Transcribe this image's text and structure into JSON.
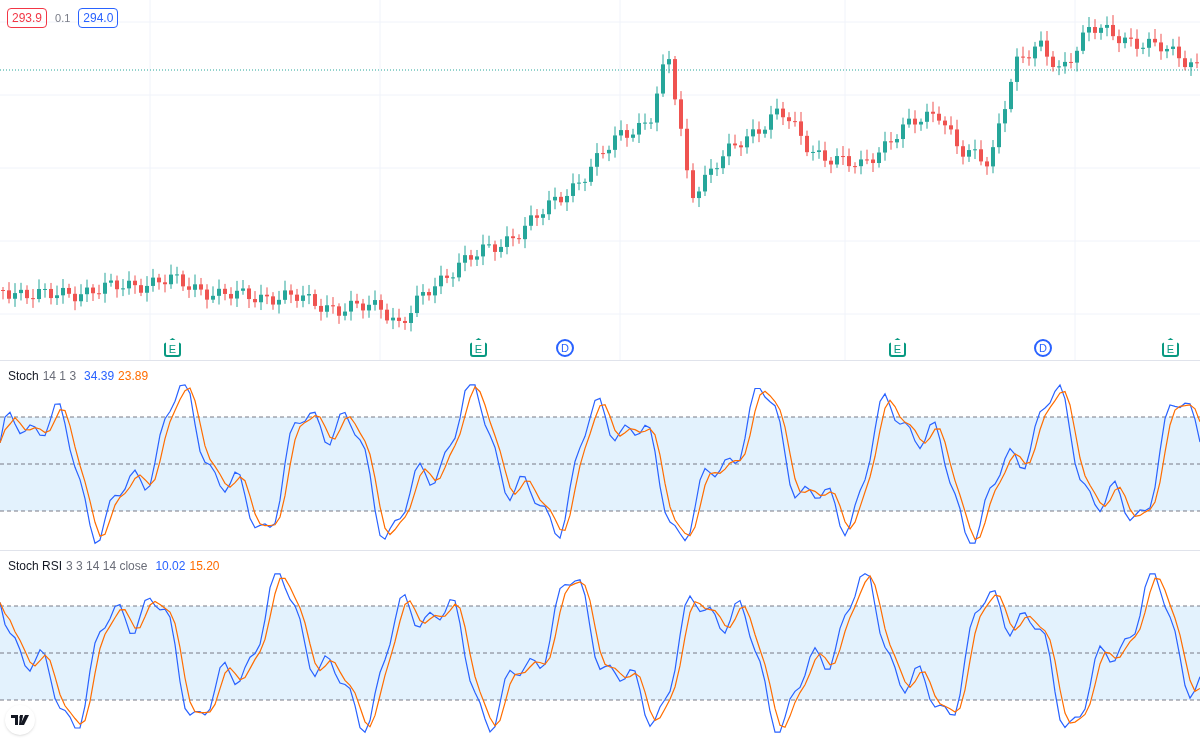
{
  "price_labels": {
    "bid": "293.9",
    "spread": "0.1",
    "ask": "294.0"
  },
  "event_markers": [
    {
      "kind": "earnings",
      "label": "E"
    },
    {
      "kind": "earnings",
      "label": "E"
    },
    {
      "kind": "dividend",
      "label": "D"
    },
    {
      "kind": "earnings",
      "label": "E"
    },
    {
      "kind": "dividend",
      "label": "D"
    },
    {
      "kind": "earnings",
      "label": "E"
    }
  ],
  "indicators": [
    {
      "name": "Stoch",
      "params": "14 1 3",
      "values": [
        {
          "text": "34.39",
          "color": "#2962ff"
        },
        {
          "text": "23.89",
          "color": "#ff6d00"
        }
      ]
    },
    {
      "name": "Stoch RSI",
      "params": "3 3 14 14 close",
      "values": [
        {
          "text": "10.02",
          "color": "#2962ff"
        },
        {
          "text": "15.20",
          "color": "#ff6d00"
        }
      ]
    }
  ]
}
